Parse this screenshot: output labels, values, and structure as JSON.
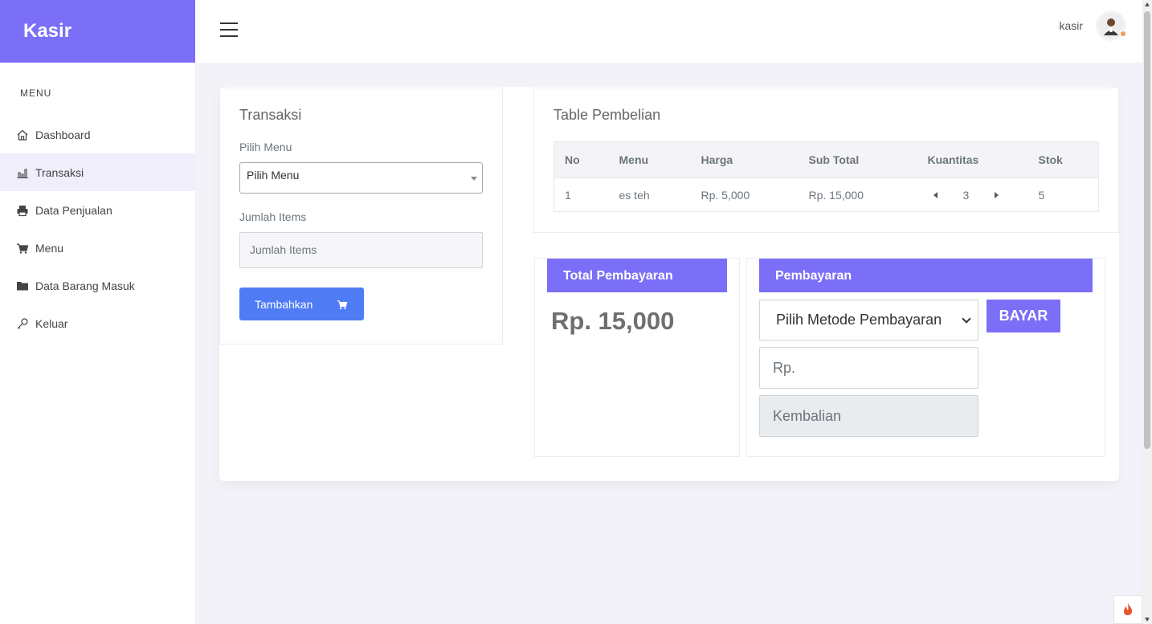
{
  "app": {
    "brand": "Kasir"
  },
  "sidebar": {
    "heading": "MENU",
    "items": [
      {
        "label": "Dashboard",
        "icon": "home-icon",
        "active": false
      },
      {
        "label": "Transaksi",
        "icon": "bar-chart-icon",
        "active": true
      },
      {
        "label": "Data Penjualan",
        "icon": "printer-icon",
        "active": false
      },
      {
        "label": "Menu",
        "icon": "cart-icon",
        "active": false
      },
      {
        "label": "Data Barang Masuk",
        "icon": "folder-icon",
        "active": false
      },
      {
        "label": "Keluar",
        "icon": "key-icon",
        "active": false
      }
    ]
  },
  "topbar": {
    "user": "kasir"
  },
  "transaksi": {
    "title": "Transaksi",
    "pilih_menu_label": "Pilih Menu",
    "pilih_menu_value": "Pilih Menu",
    "jumlah_label": "Jumlah Items",
    "jumlah_placeholder": "Jumlah Items",
    "add_button": "Tambahkan"
  },
  "pembelian": {
    "title": "Table Pembelian",
    "columns": [
      "No",
      "Menu",
      "Harga",
      "Sub Total",
      "Kuantitas",
      "Stok"
    ],
    "rows": [
      {
        "no": "1",
        "menu": "es teh",
        "harga": "Rp. 5,000",
        "subtotal": "Rp. 15,000",
        "qty": "3",
        "stok": "5"
      }
    ]
  },
  "total": {
    "title": "Total Pembayaran",
    "amount": "Rp. 15,000"
  },
  "pembayaran": {
    "title": "Pembayaran",
    "method_value": "Pilih Metode Pembayaran",
    "pay_button": "BAYAR",
    "rp_placeholder": "Rp.",
    "kembalian_placeholder": "Kembalian"
  },
  "colors": {
    "primary": "#7b6ff7",
    "button_blue": "#4f7cf5"
  }
}
